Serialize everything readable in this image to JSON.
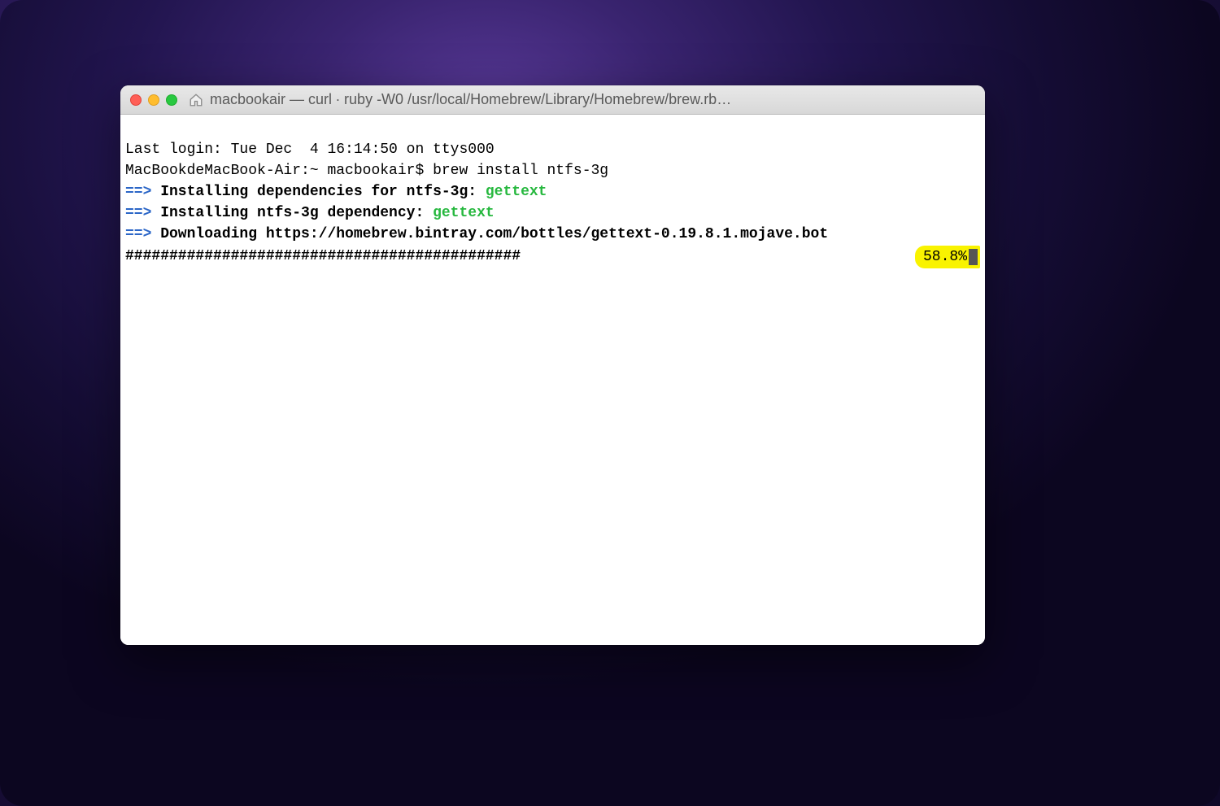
{
  "window": {
    "title": "macbookair — curl ∙ ruby -W0 /usr/local/Homebrew/Library/Homebrew/brew.rb…"
  },
  "terminal": {
    "login_line": "Last login: Tue Dec  4 16:14:50 on ttys000",
    "prompt_prefix": "MacBookdeMacBook-Air:~ macbookair$ ",
    "command": "brew install ntfs-3g",
    "line1_arrow": "==>",
    "line1_text": " Installing dependencies for ntfs-3g: ",
    "line1_pkg": "gettext",
    "line2_arrow": "==>",
    "line2_text": " Installing ntfs-3g dependency: ",
    "line2_pkg": "gettext",
    "line3_arrow": "==>",
    "line3_text": " Downloading https://homebrew.bintray.com/bottles/gettext-0.19.8.1.mojave.bot",
    "progress_bar": "#############################################",
    "progress_percent": "58.8%"
  },
  "colors": {
    "brew_arrow": "#2b66c7",
    "brew_green": "#27b83f",
    "highlight": "#f9f300"
  }
}
